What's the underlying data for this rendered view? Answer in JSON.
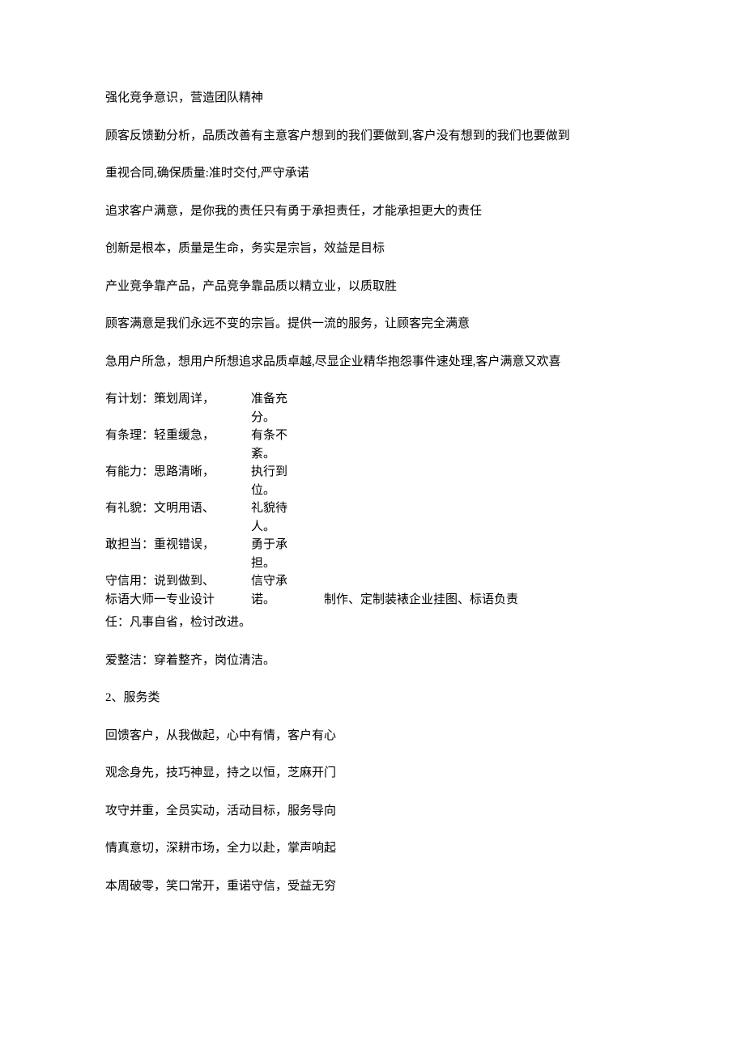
{
  "paragraphs_top": [
    "强化竞争意识，营造团队精神",
    "顾客反馈勤分析，品质改善有主意客户想到的我们要做到,客户没有想到的我们也要做到",
    "重视合同,确保质量:准时交付,严守承诺",
    "追求客户满意，是你我的责任只有勇于承担责任，才能承担更大的责任",
    "创新是根本，质量是生命，务实是宗旨，效益是目标",
    "产业竞争靠产品，产品竞争靠品质以精立业，以质取胜",
    "顾客满意是我们永远不变的宗旨。提供一流的服务，让顾客完全满意",
    "急用户所急，想用户所想追求品质卓越,尽显企业精华抱怨事件速处理,客户满意又欢喜"
  ],
  "grid": {
    "rows": [
      {
        "a": "有计划：策划周详，",
        "b": "准备充分。"
      },
      {
        "a": "有条理：轻重缓急，",
        "b": "有条不紊。"
      },
      {
        "a": "有能力：思路清晰，",
        "b": "执行到位。"
      },
      {
        "a": "有礼貌：文明用语、",
        "b": "礼貌待人。"
      },
      {
        "a": "敢担当：重视错误，",
        "b": "勇于承担。"
      },
      {
        "a": "守信用：说到做到、",
        "b": "信守承"
      }
    ],
    "last_row_left": "标语大师一专业设计",
    "last_row_overlap": "诺。",
    "last_row_right": "制作、定制装裱企业挂图、标语负责",
    "tail": "任：凡事自省，检讨改进。"
  },
  "paragraphs_mid": [
    "爱整洁：穿着整齐，岗位清洁。"
  ],
  "section2_heading": "2、服务类",
  "paragraphs_bottom": [
    "回馈客户，从我做起，心中有情，客户有心",
    "观念身先，技巧神显，持之以恒，芝麻开门",
    "攻守并重，全员实动，活动目标，服务导向",
    "情真意切，深耕市场，全力以赴，掌声响起",
    "本周破零，笑口常开，重诺守信，受益无穷"
  ]
}
